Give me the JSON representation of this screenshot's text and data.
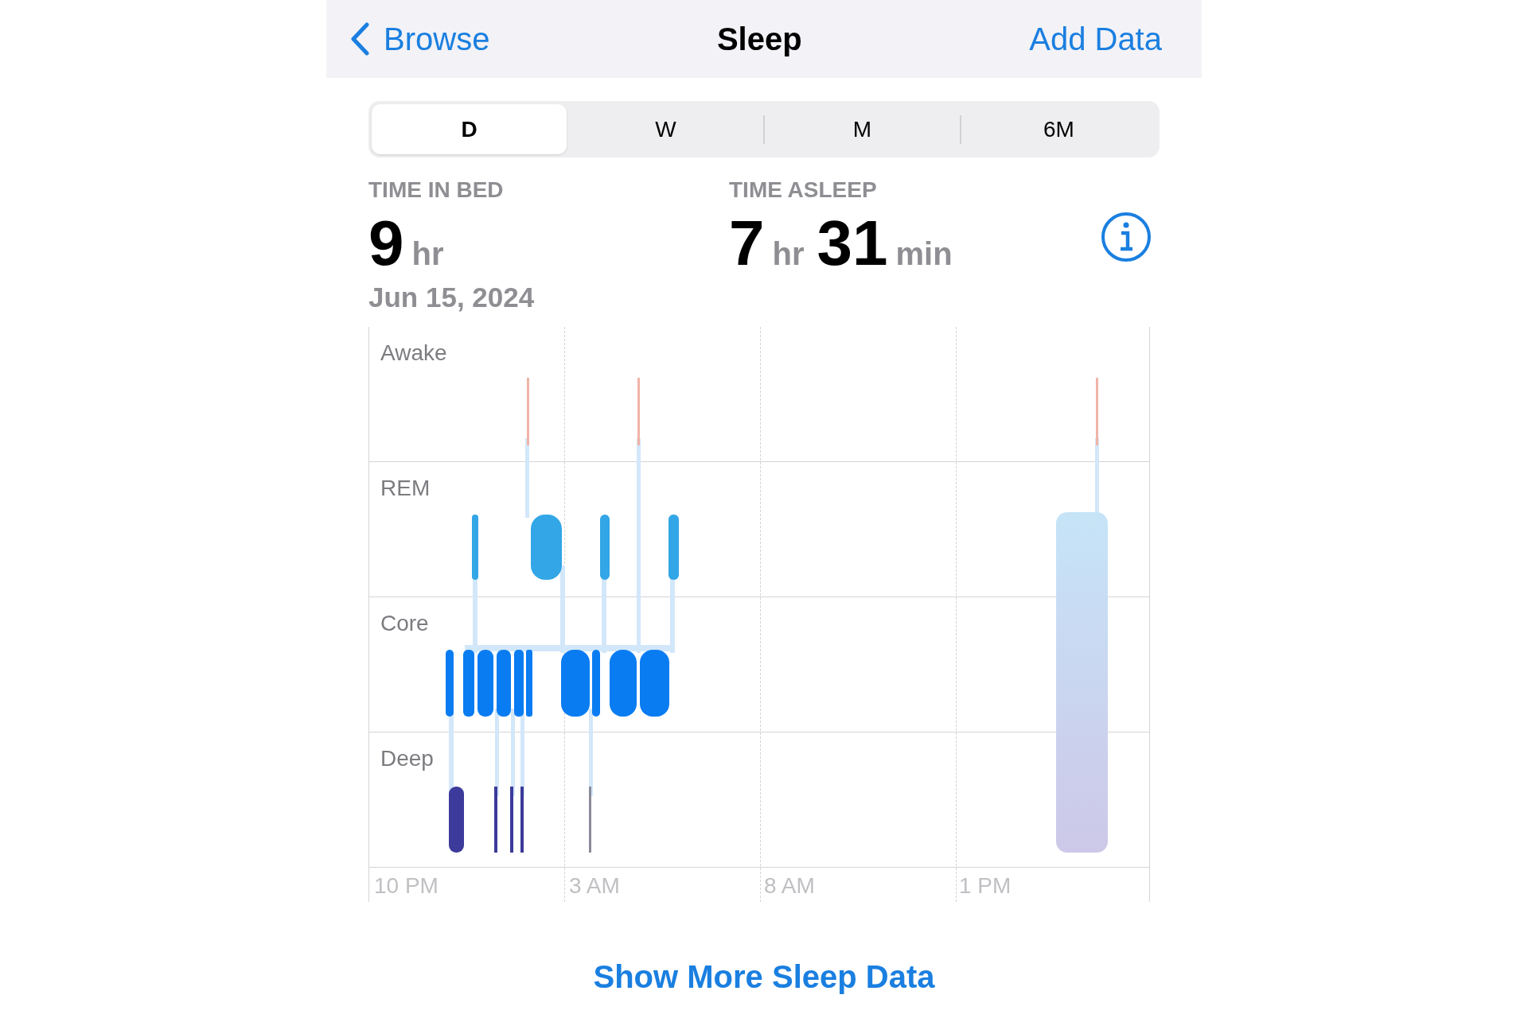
{
  "nav": {
    "back": "Browse",
    "title": "Sleep",
    "action": "Add Data"
  },
  "segments": [
    {
      "label": "D",
      "selected": true
    },
    {
      "label": "W",
      "selected": false
    },
    {
      "label": "M",
      "selected": false
    },
    {
      "label": "6M",
      "selected": false
    }
  ],
  "summary": [
    {
      "label": "TIME IN BED",
      "parts": [
        {
          "value": "9",
          "unit": "hr"
        }
      ]
    },
    {
      "label": "TIME ASLEEP",
      "parts": [
        {
          "value": "7",
          "unit": "hr"
        },
        {
          "value": "31",
          "unit": "min"
        }
      ]
    }
  ],
  "date": "Jun 15, 2024",
  "chart": {
    "stages": [
      "Awake",
      "REM",
      "Core",
      "Deep"
    ],
    "x_labels": [
      "10 PM",
      "3 AM",
      "8 AM",
      "1 PM"
    ]
  },
  "link": "Show More Sleep Data"
}
